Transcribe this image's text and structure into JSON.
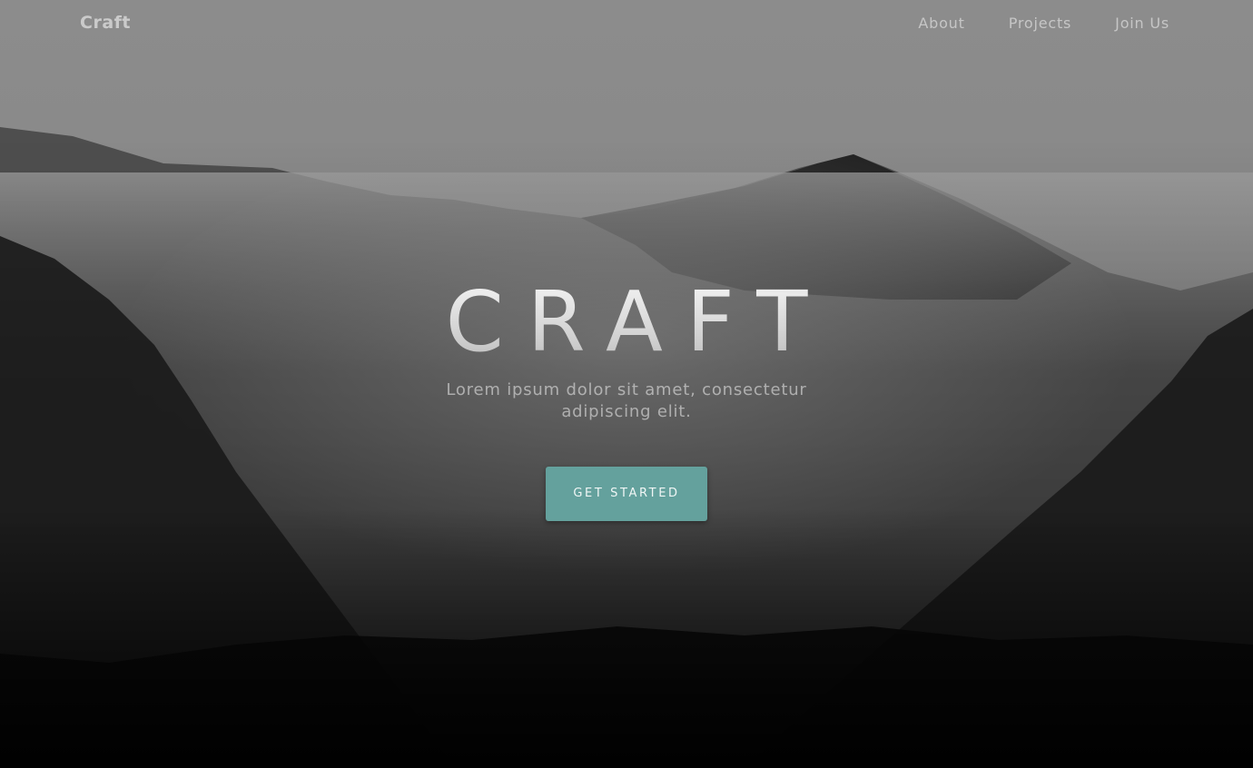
{
  "navbar": {
    "brand": "Craft",
    "links": [
      "About",
      "Projects",
      "Join Us"
    ]
  },
  "hero": {
    "title": "CRAFT",
    "subtitle": "Lorem ipsum dolor sit amet, consectetur adipiscing elit.",
    "cta_label": "GET STARTED"
  },
  "colors": {
    "accent": "#64a19d",
    "background_top": "#8c8c8c",
    "background_bottom": "#050505"
  },
  "background": {
    "image": "misty-mountain-forest"
  }
}
